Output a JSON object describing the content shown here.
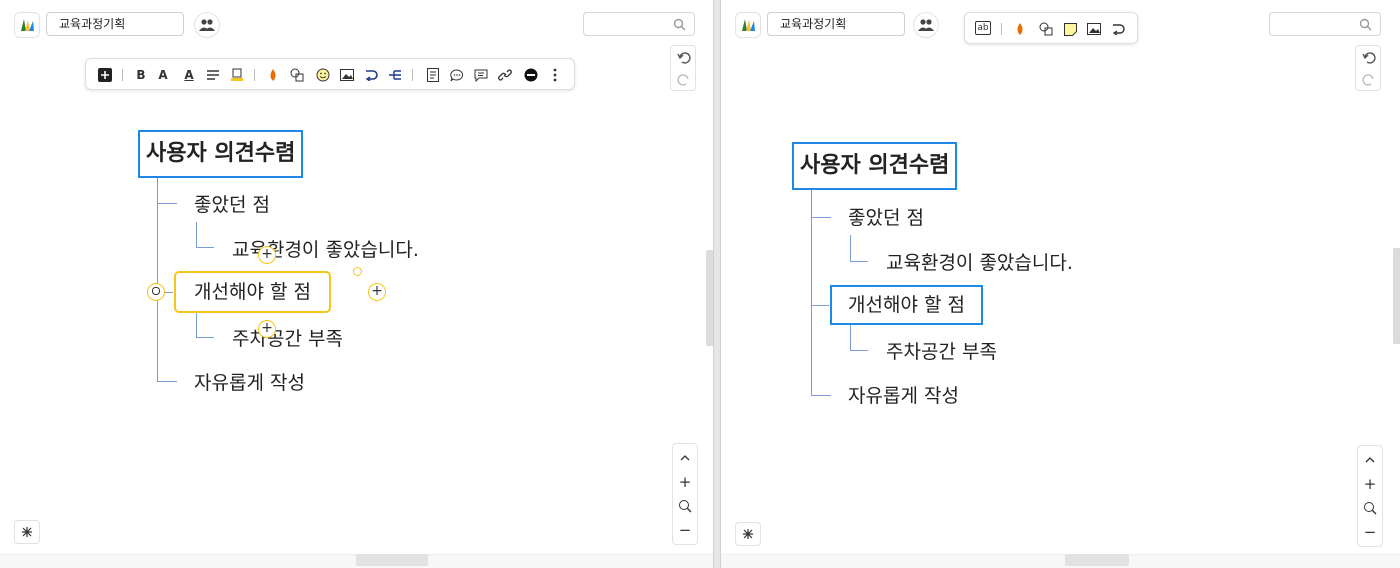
{
  "left": {
    "title": "교육과정기획",
    "toolbar_text": {
      "bold": "B",
      "fontsize": "A",
      "fontcolor": "A"
    },
    "root": "사용자 의견수렴",
    "nodes": {
      "liked": "좋았던 점",
      "liked_detail": "교육환경이 좋았습니다.",
      "improve": "개선해야 할 점",
      "improve_detail": "주차공간 부족",
      "free": "자유롭게 작성"
    }
  },
  "right": {
    "title": "교육과정기획",
    "toolbar_text": {
      "ab": "ab"
    },
    "root": "사용자 의견수렴",
    "nodes": {
      "liked": "좋았던 점",
      "liked_detail": "교육환경이 좋았습니다.",
      "improve": "개선해야 할 점",
      "improve_detail": "주차공간 부족",
      "free": "자유롭게 작성"
    }
  },
  "colors": {
    "accent_blue": "#1e88e5",
    "selection_yellow": "#f5c518",
    "connector": "#7a9cd6",
    "drop_orange": "#ef6c00"
  },
  "icons": [
    "logo-icon",
    "people-icon",
    "search-icon",
    "undo-icon",
    "redo-icon",
    "add-icon",
    "bold-icon",
    "font-size-icon",
    "font-color-icon",
    "align-icon",
    "highlight-icon",
    "fill-color-icon",
    "shape-icon",
    "emoji-icon",
    "image-icon",
    "relation-icon",
    "structure-icon",
    "note-icon",
    "comment-icon",
    "memo-icon",
    "link-icon",
    "remove-icon",
    "more-icon",
    "text-icon",
    "sticky-note-icon",
    "chevron-up-icon",
    "zoom-in-icon",
    "zoom-reset-icon",
    "zoom-out-icon",
    "debug-icon",
    "plus-icon"
  ]
}
